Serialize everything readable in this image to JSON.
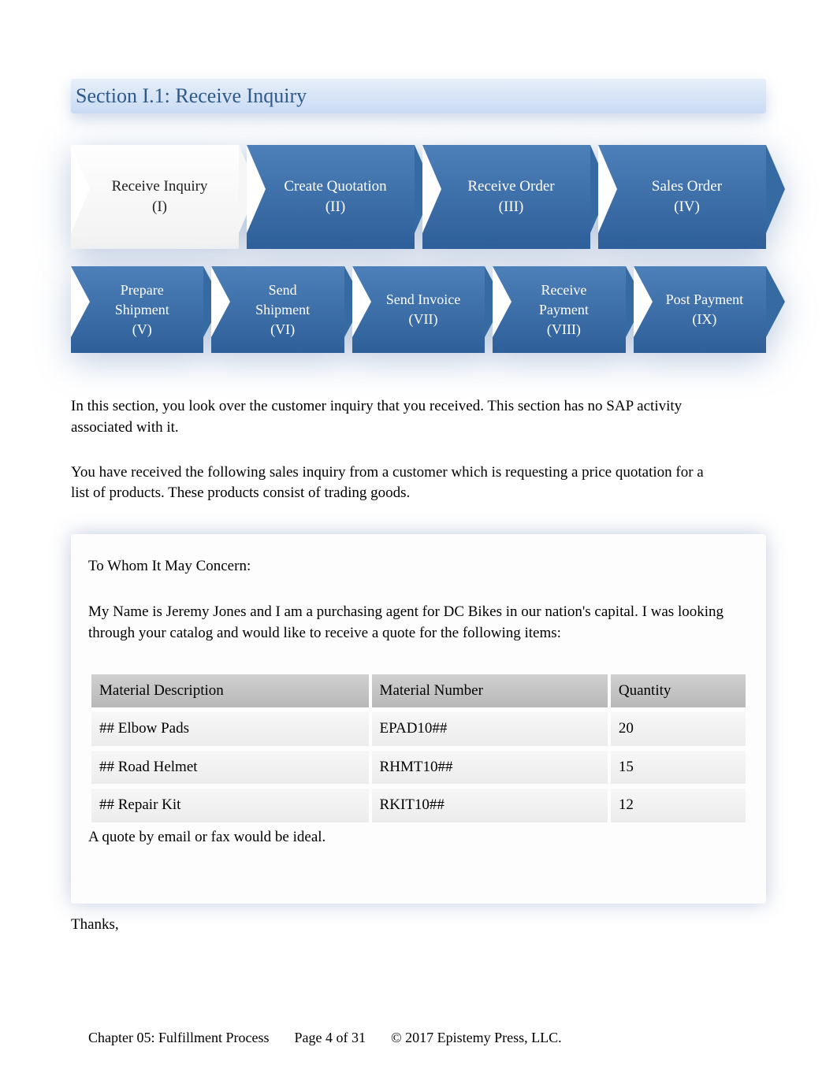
{
  "section_title": "Section I.1: Receive Inquiry",
  "flow_row1": [
    {
      "title": "Receive Inquiry",
      "roman": "(I)",
      "current": true
    },
    {
      "title": "Create Quotation",
      "roman": "(II)",
      "current": false
    },
    {
      "title": "Receive Order",
      "roman": "(III)",
      "current": false
    },
    {
      "title": "Sales Order",
      "roman": "(IV)",
      "current": false
    }
  ],
  "flow_row2": [
    {
      "title": "Prepare Shipment",
      "roman": "(V)"
    },
    {
      "title": "Send Shipment",
      "roman": "(VI)"
    },
    {
      "title": "Send Invoice",
      "roman": "(VII)"
    },
    {
      "title": "Receive Payment",
      "roman": "(VIII)"
    },
    {
      "title": "Post Payment",
      "roman": "(IX)"
    }
  ],
  "intro_p1": "In this section, you look over the customer inquiry that you received. This section has no SAP activity associated with it.",
  "intro_p2": "You have received the following sales inquiry from a customer which is requesting a price quotation for a list of products. These products consist of trading goods.",
  "letter": {
    "salutation": "To Whom It May Concern:",
    "body": "My Name is Jeremy Jones and I am a purchasing agent for DC Bikes in our nation's capital. I was looking through your catalog and would like to receive a quote for the following items:",
    "table_headers": [
      "Material Description",
      "Material Number",
      "Quantity"
    ],
    "rows": [
      {
        "desc": "## Elbow Pads",
        "num": "EPAD10##",
        "qty": "20"
      },
      {
        "desc": "## Road Helmet",
        "num": "RHMT10##",
        "qty": "15"
      },
      {
        "desc": "## Repair Kit",
        "num": "RKIT10##",
        "qty": "12"
      }
    ],
    "closing": "A quote by email or fax would be ideal.",
    "thanks": "Thanks,"
  },
  "footer": {
    "chapter": "Chapter 05: Fulfillment Process",
    "page": "Page 4 of 31",
    "copyright": "© 2017 Epistemy Press, LLC."
  }
}
